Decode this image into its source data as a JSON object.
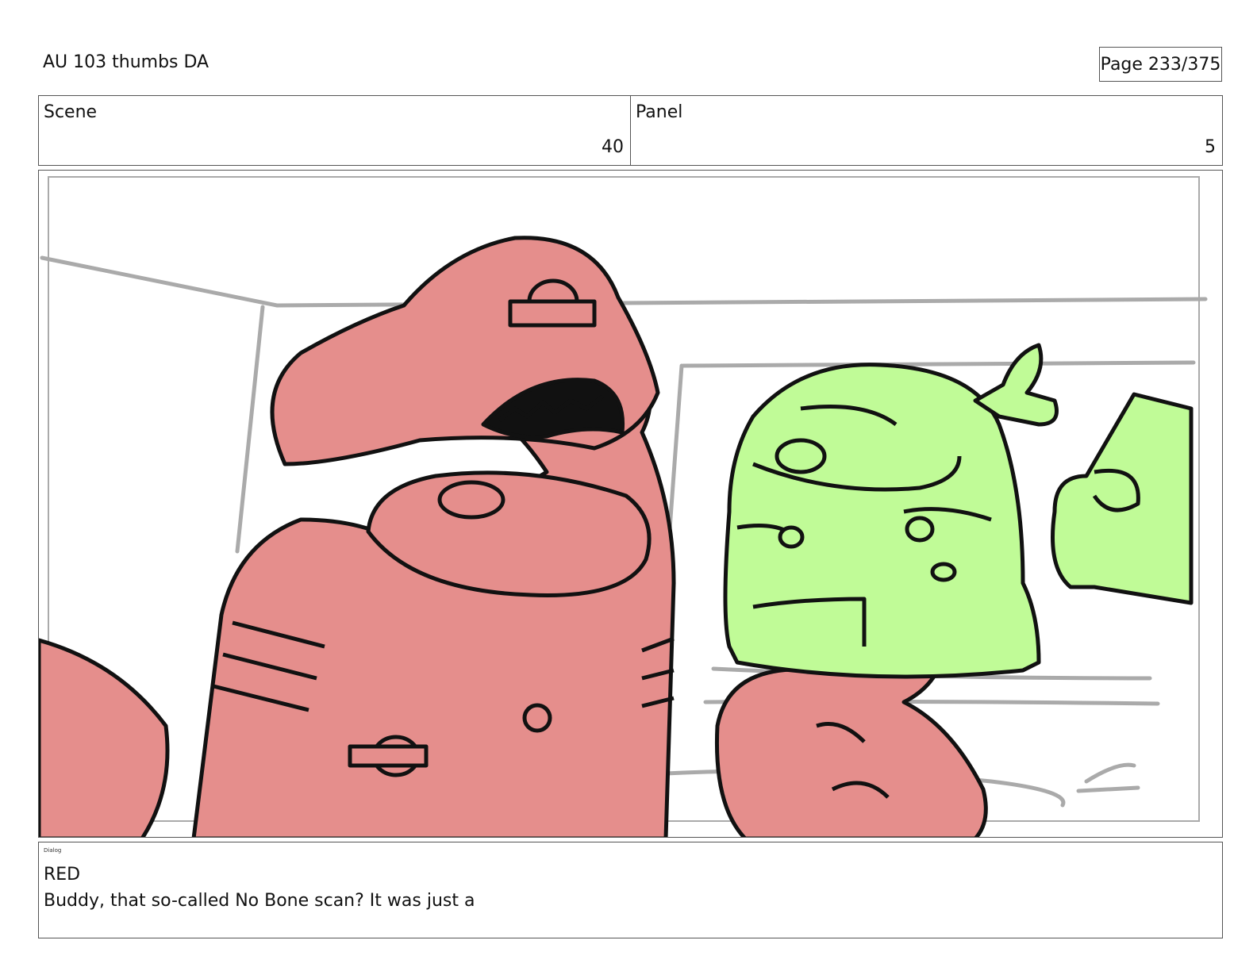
{
  "header": {
    "title": "AU 103 thumbs DA",
    "page_indicator": "Page 233/375"
  },
  "info": {
    "scene_label": "Scene",
    "scene_value": "40",
    "panel_label": "Panel",
    "panel_value": "5"
  },
  "panel_image": {
    "characters": [
      "red crewmate",
      "green crewmate"
    ],
    "colors": {
      "red_fill": "#e58e8c",
      "green_fill": "#c0fb97",
      "background_lines": "#aaaaaa",
      "ink": "#111111"
    }
  },
  "dialog": {
    "label": "Dialog",
    "speaker": "RED",
    "line": "Buddy, that so-called No Bone scan? It was just a"
  }
}
